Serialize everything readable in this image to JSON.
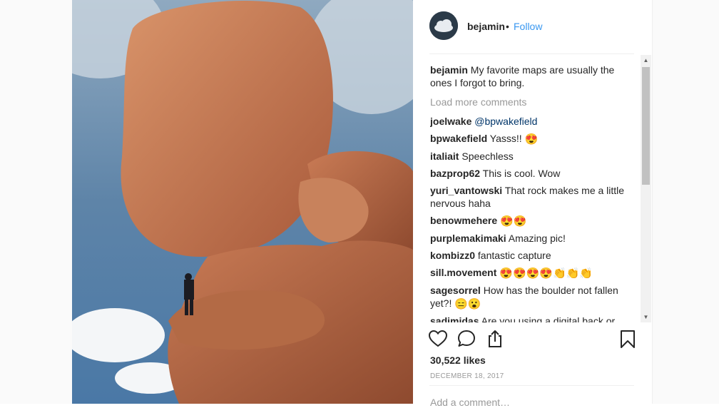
{
  "post": {
    "author": "bejamin",
    "separator": "•",
    "follow_label": "Follow"
  },
  "caption": {
    "user": "bejamin",
    "text": "My favorite maps are usually the ones I forgot to bring."
  },
  "load_more_label": "Load more comments",
  "comments": [
    {
      "user": "joelwake",
      "mention": "@bpwakefield",
      "text": "",
      "emoji": ""
    },
    {
      "user": "bpwakefield",
      "mention": "",
      "text": "Yasss!!",
      "emoji": "😍"
    },
    {
      "user": "italiait",
      "mention": "",
      "text": "Speechless",
      "emoji": ""
    },
    {
      "user": "bazprop62",
      "mention": "",
      "text": "This is cool. Wow",
      "emoji": ""
    },
    {
      "user": "yuri_vantowski",
      "mention": "",
      "text": "That rock makes me a little nervous haha",
      "emoji": ""
    },
    {
      "user": "benowmehere",
      "mention": "",
      "text": "",
      "emoji": "😍😍"
    },
    {
      "user": "purplemakimaki",
      "mention": "",
      "text": "Amazing pic!",
      "emoji": ""
    },
    {
      "user": "kombizz0",
      "mention": "",
      "text": "fantastic capture",
      "emoji": ""
    },
    {
      "user": "sill.movement",
      "mention": "",
      "text": "",
      "emoji": "😍😍😍😍👏👏👏"
    },
    {
      "user": "sagesorrel",
      "mention": "",
      "text": "How has the boulder not fallen yet?!",
      "emoji": "😑😮"
    },
    {
      "user": "sadimidas",
      "mention": "",
      "text": "Are you using a digital back or",
      "emoji": ""
    }
  ],
  "likes_label": "30,522 likes",
  "date_label": "DECEMBER 18, 2017",
  "add_comment_placeholder": "Add a comment…",
  "icons": {
    "like": "heart-icon",
    "comment": "comment-icon",
    "share": "share-icon",
    "save": "bookmark-icon"
  },
  "colors": {
    "follow": "#3897f0",
    "muted": "#999999",
    "mention": "#003569"
  }
}
